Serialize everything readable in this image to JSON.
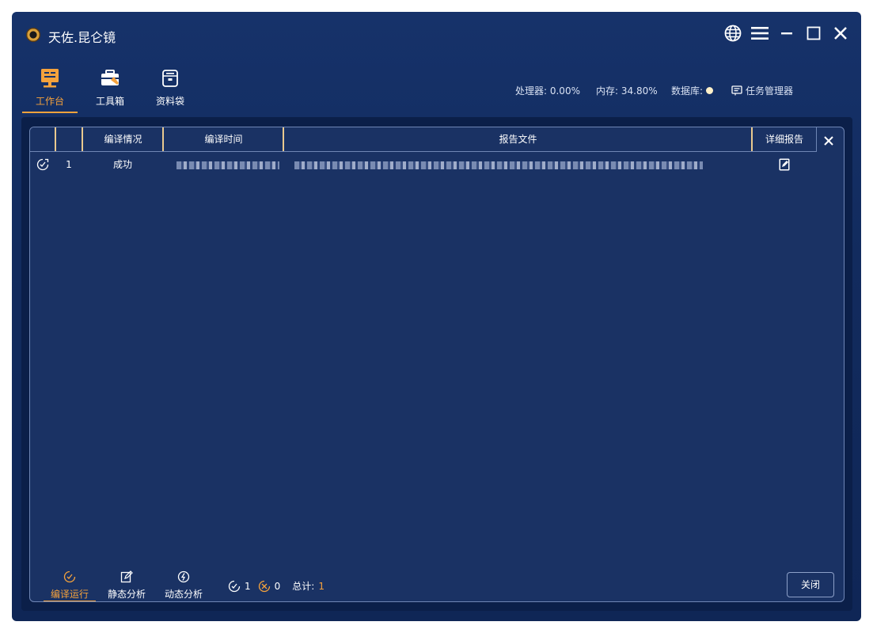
{
  "app": {
    "title": "天佐.昆仑镜"
  },
  "window_controls": [
    "globe-icon",
    "menu-icon",
    "minimize-icon",
    "maximize-icon",
    "close-icon"
  ],
  "toolbar": {
    "items": [
      {
        "label": "工作台",
        "icon": "workbench-icon",
        "active": true
      },
      {
        "label": "工具箱",
        "icon": "toolbox-icon",
        "active": false
      },
      {
        "label": "资料袋",
        "icon": "folder-bag-icon",
        "active": false
      }
    ]
  },
  "stats": {
    "cpu": "处理器: 0.00%",
    "memory": "内存: 34.80%",
    "database": "数据库:",
    "task_manager": "任务管理器"
  },
  "table": {
    "headers": [
      "",
      "",
      "编译情况",
      "编译时间",
      "报告文件",
      "详细报告"
    ],
    "rows": [
      {
        "index": "1",
        "status": "成功",
        "time": "",
        "file": "",
        "icon": "compile-icon",
        "detail_icon": "report-edit-icon"
      }
    ]
  },
  "bottom": {
    "tabs": [
      {
        "label": "编译运行",
        "icon": "compile-icon",
        "active": true
      },
      {
        "label": "静态分析",
        "icon": "edit-square-icon",
        "active": false
      },
      {
        "label": "动态分析",
        "icon": "dynamic-icon",
        "active": false
      }
    ],
    "success_count": "1",
    "fail_count": "0",
    "total_label": "总计:",
    "total_value": "1",
    "close_label": "关闭"
  },
  "colors": {
    "accent": "#f5a23c",
    "background": "#16326a",
    "panel": "#1a3264",
    "separator": "#e9c98f"
  }
}
